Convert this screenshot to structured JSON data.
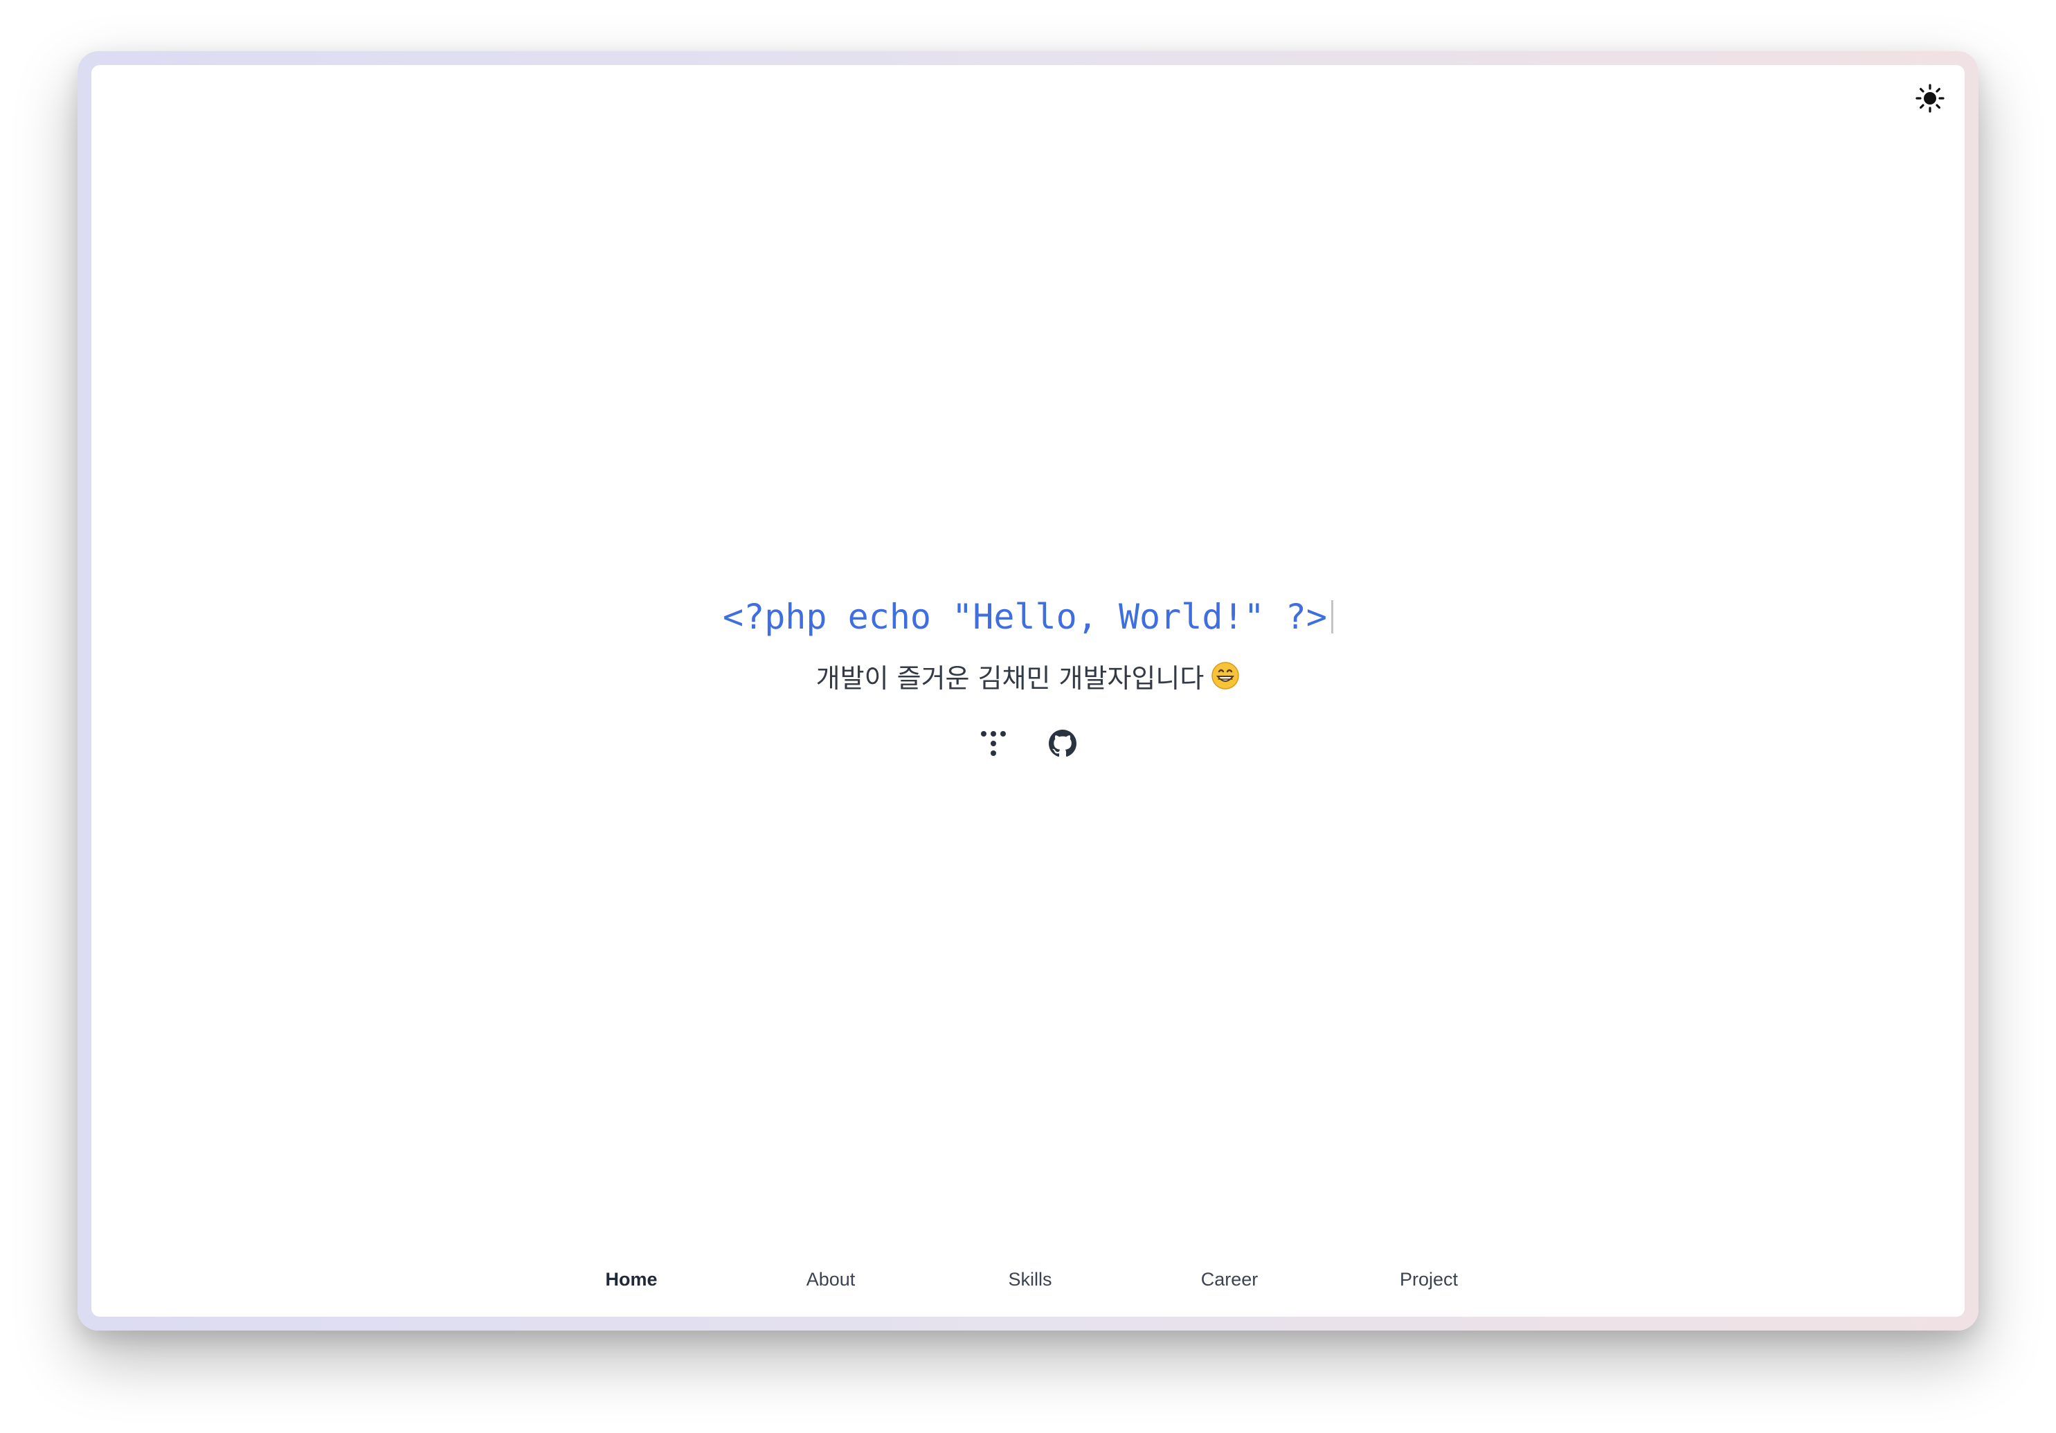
{
  "theme_toggle": {
    "icon": "sun-icon"
  },
  "hero": {
    "code_line": "<?php echo \"Hello, World!\" ?>",
    "subtitle": "개발이 즐거운 김채민 개발자입니다",
    "subtitle_emoji": "grinning-face-icon"
  },
  "socials": [
    {
      "icon": "tistory-icon"
    },
    {
      "icon": "github-icon"
    }
  ],
  "nav": {
    "active": "Home",
    "items": [
      {
        "label": "Home"
      },
      {
        "label": "About"
      },
      {
        "label": "Skills"
      },
      {
        "label": "Career"
      },
      {
        "label": "Project"
      }
    ]
  },
  "colors": {
    "code_accent": "#3f6ee0",
    "text": "#333a45",
    "frame_gradient_left": "#dcdcf3",
    "frame_gradient_right": "#f0e2e4"
  }
}
